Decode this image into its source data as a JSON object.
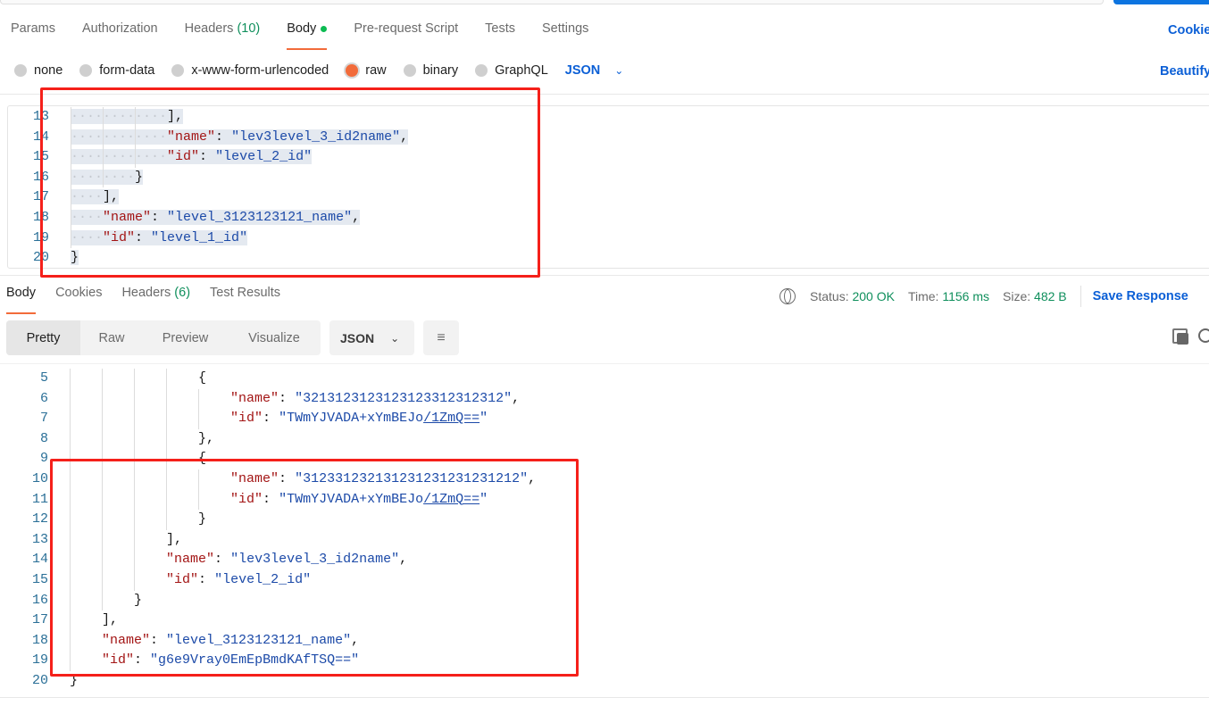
{
  "request": {
    "tabs": [
      {
        "label": "Params"
      },
      {
        "label": "Authorization"
      },
      {
        "label": "Headers",
        "count": "(10)"
      },
      {
        "label": "Body",
        "active": true
      },
      {
        "label": "Pre-request Script"
      },
      {
        "label": "Tests"
      },
      {
        "label": "Settings"
      }
    ],
    "cookies_link": "Cookies",
    "body_types": [
      "none",
      "form-data",
      "x-www-form-urlencoded",
      "raw",
      "binary",
      "GraphQL"
    ],
    "selected_body_type": "raw",
    "language": "JSON",
    "beautify_link": "Beautify",
    "editor_lines": [
      {
        "n": "13",
        "indent": 12,
        "text": [
          [
            "p",
            "],"
          ]
        ]
      },
      {
        "n": "14",
        "indent": 12,
        "text": [
          [
            "k",
            "\"name\""
          ],
          [
            "p",
            ": "
          ],
          [
            "v",
            "\"lev3level_3_id2name\""
          ],
          [
            "p",
            ","
          ]
        ]
      },
      {
        "n": "15",
        "indent": 12,
        "text": [
          [
            "k",
            "\"id\""
          ],
          [
            "p",
            ": "
          ],
          [
            "v",
            "\"level_2_id\""
          ]
        ]
      },
      {
        "n": "16",
        "indent": 8,
        "text": [
          [
            "p",
            "}"
          ]
        ]
      },
      {
        "n": "17",
        "indent": 4,
        "text": [
          [
            "p",
            "],"
          ]
        ]
      },
      {
        "n": "18",
        "indent": 4,
        "text": [
          [
            "k",
            "\"name\""
          ],
          [
            "p",
            ": "
          ],
          [
            "v",
            "\"level_3123123121_name\""
          ],
          [
            "p",
            ","
          ]
        ]
      },
      {
        "n": "19",
        "indent": 4,
        "text": [
          [
            "k",
            "\"id\""
          ],
          [
            "p",
            ": "
          ],
          [
            "v",
            "\"level_1_id\""
          ]
        ]
      },
      {
        "n": "20",
        "indent": 0,
        "text": [
          [
            "p",
            "}"
          ]
        ]
      }
    ]
  },
  "response": {
    "tabs": [
      {
        "label": "Body",
        "active": true
      },
      {
        "label": "Cookies"
      },
      {
        "label": "Headers",
        "count": "(6)"
      },
      {
        "label": "Test Results"
      }
    ],
    "status_label": "Status:",
    "status_value": "200 OK",
    "time_label": "Time:",
    "time_value": "1156 ms",
    "size_label": "Size:",
    "size_value": "482 B",
    "save_response": "Save Response",
    "view_modes": [
      "Pretty",
      "Raw",
      "Preview",
      "Visualize"
    ],
    "selected_view": "Pretty",
    "format": "JSON",
    "lines": [
      {
        "n": "5",
        "indent": 16,
        "text": [
          [
            "p",
            "{"
          ]
        ]
      },
      {
        "n": "6",
        "indent": 20,
        "text": [
          [
            "k",
            "\"name\""
          ],
          [
            "p",
            ": "
          ],
          [
            "v",
            "\"3213123123123123312312312\""
          ],
          [
            "p",
            ","
          ]
        ]
      },
      {
        "n": "7",
        "indent": 20,
        "text": [
          [
            "k",
            "\"id\""
          ],
          [
            "p",
            ": "
          ],
          [
            "v",
            "\"TWmYJVADA+xYmBEJo"
          ],
          [
            "u",
            "/1ZmQ=="
          ],
          [
            "v",
            "\""
          ]
        ]
      },
      {
        "n": "8",
        "indent": 16,
        "text": [
          [
            "p",
            "},"
          ]
        ]
      },
      {
        "n": "9",
        "indent": 16,
        "text": [
          [
            "p",
            "{"
          ]
        ]
      },
      {
        "n": "10",
        "indent": 20,
        "text": [
          [
            "k",
            "\"name\""
          ],
          [
            "p",
            ": "
          ],
          [
            "v",
            "\"312331232131231231231231212\""
          ],
          [
            "p",
            ","
          ]
        ]
      },
      {
        "n": "11",
        "indent": 20,
        "text": [
          [
            "k",
            "\"id\""
          ],
          [
            "p",
            ": "
          ],
          [
            "v",
            "\"TWmYJVADA+xYmBEJo"
          ],
          [
            "u",
            "/1ZmQ=="
          ],
          [
            "v",
            "\""
          ]
        ]
      },
      {
        "n": "12",
        "indent": 16,
        "text": [
          [
            "p",
            "}"
          ]
        ]
      },
      {
        "n": "13",
        "indent": 12,
        "text": [
          [
            "p",
            "],"
          ]
        ]
      },
      {
        "n": "14",
        "indent": 12,
        "text": [
          [
            "k",
            "\"name\""
          ],
          [
            "p",
            ": "
          ],
          [
            "v",
            "\"lev3level_3_id2name\""
          ],
          [
            "p",
            ","
          ]
        ]
      },
      {
        "n": "15",
        "indent": 12,
        "text": [
          [
            "k",
            "\"id\""
          ],
          [
            "p",
            ": "
          ],
          [
            "v",
            "\"level_2_id\""
          ]
        ]
      },
      {
        "n": "16",
        "indent": 8,
        "text": [
          [
            "p",
            "}"
          ]
        ]
      },
      {
        "n": "17",
        "indent": 4,
        "text": [
          [
            "p",
            "],"
          ]
        ]
      },
      {
        "n": "18",
        "indent": 4,
        "text": [
          [
            "k",
            "\"name\""
          ],
          [
            "p",
            ": "
          ],
          [
            "v",
            "\"level_3123123121_name\""
          ],
          [
            "p",
            ","
          ]
        ]
      },
      {
        "n": "19",
        "indent": 4,
        "text": [
          [
            "k",
            "\"id\""
          ],
          [
            "p",
            ": "
          ],
          [
            "v",
            "\"g6e9Vray0EmEpBmdKAfTSQ==\""
          ]
        ]
      },
      {
        "n": "20",
        "indent": 0,
        "text": [
          [
            "p",
            "}"
          ]
        ]
      }
    ]
  },
  "colors": {
    "accent": "#f26b3a",
    "link": "#0b5fd6",
    "success": "#0f8f5c",
    "annotation": "#f5201a"
  }
}
